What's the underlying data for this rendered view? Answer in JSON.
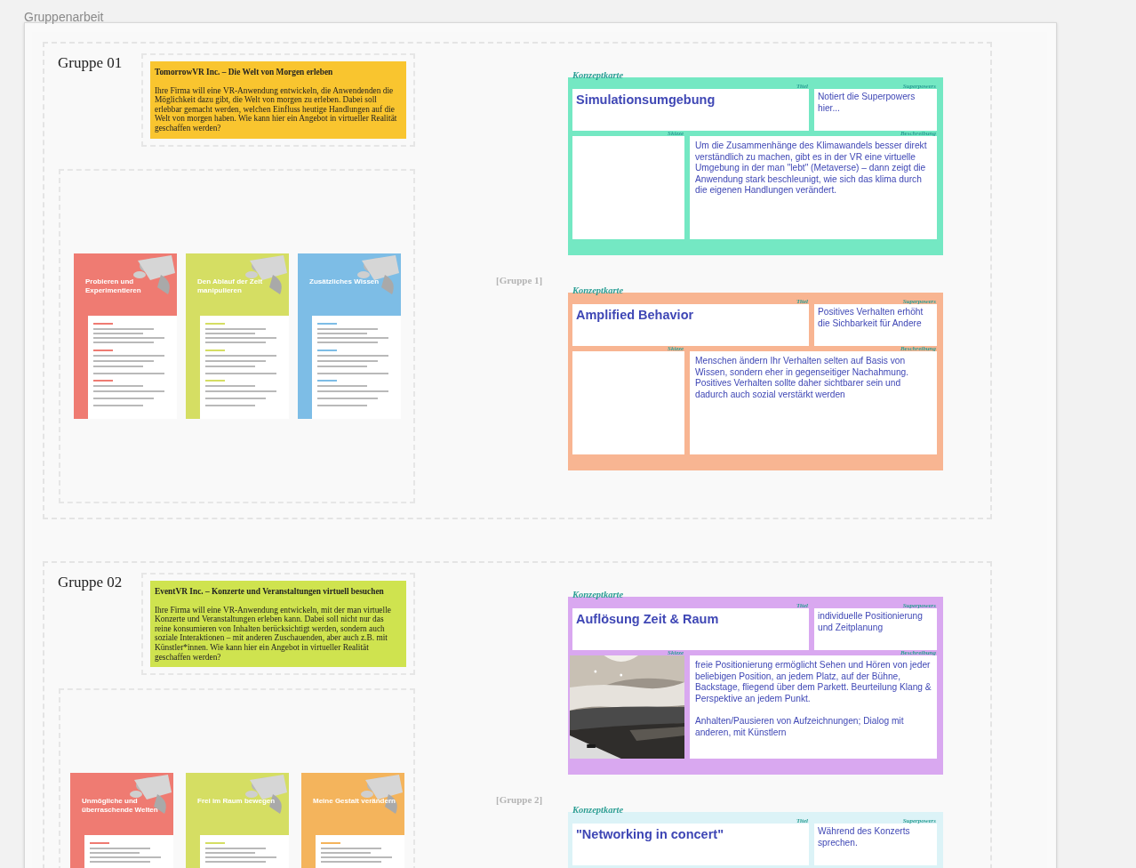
{
  "board": {
    "title": "Gruppenarbeit"
  },
  "groups": [
    {
      "label": "Gruppe 01",
      "tag": "[Gruppe 1]",
      "task": {
        "title": "TomorrowVR Inc. – Die Welt von Morgen erleben",
        "text": "Ihre Firma will eine VR-Anwendung entwickeln, die Anwendenden die Möglichkeit dazu gibt, die Welt von morgen zu erleben. Dabei soll erlebbar gemacht werden, welchen Einfluss heutige Handlungen auf die Welt von morgen haben. Wie kann hier ein Angebot in virtueller Realität geschaffen werden?",
        "color": "#f9c52f"
      },
      "method_cards": [
        {
          "title": "Probieren und Experimentieren",
          "color": "#ef7b72"
        },
        {
          "title": "Den Ablauf der Zeit manipulieren",
          "color": "#d5de63"
        },
        {
          "title": "Zusätzliches Wissen",
          "color": "#7dbde6"
        }
      ],
      "concept_cards": [
        {
          "heading": "Konzeptkarte",
          "color": "#74e8c3",
          "title_label": "Titel",
          "title": "Simulationsumgebung",
          "superpowers_label": "Superpowers",
          "superpowers": "Notiert die Superpowers hier...",
          "sketch_label": "Skizze",
          "sketch": {
            "kind": "empty"
          },
          "description_label": "Beschreibung",
          "description": "Um die Zusammenhänge des Klimawandels besser direkt verständlich zu machen, gibt es in der VR eine virtuelle Umgebung in der man \"lebt\" (Metaverse) – dann zeigt die Anwendung stark beschleunigt, wie sich das klima durch die eigenen Handlungen verändert."
        },
        {
          "heading": "Konzeptkarte",
          "color": "#f8b592",
          "title_label": "Titel",
          "title": "Amplified Behavior",
          "superpowers_label": "Superpowers",
          "superpowers": "Positives Verhalten erhöht die Sichbarkeit für Andere",
          "sketch_label": "Skizze",
          "sketch": {
            "kind": "empty"
          },
          "description_label": "Beschreibung",
          "description": "Menschen ändern Ihr Verhalten selten auf Basis von Wissen, sondern eher in gegenseitiger Nachahmung. Positives Verhalten sollte daher sichtbarer sein und dadurch auch sozial verstärkt werden"
        }
      ]
    },
    {
      "label": "Gruppe 02",
      "tag": "[Gruppe 2]",
      "task": {
        "title": "EventVR Inc. – Konzerte und Veranstaltungen virtuell besuchen",
        "text": "Ihre Firma will eine VR-Anwendung entwickeln, mit der man virtuelle Konzerte und Veranstaltungen erleben kann. Dabei soll nicht nur das reine konsumieren von Inhalten berücksichtigt werden, sondern auch soziale Interaktionen – mit anderen Zuschauenden, aber auch z.B. mit Künstler*innen. Wie kann hier ein Angebot in virtueller Realität geschaffen werden?",
        "color": "#cfe34f"
      },
      "method_cards": [
        {
          "title": "Unmögliche und überraschende Welten",
          "color": "#ef7b72"
        },
        {
          "title": "Frei im Raum bewegen",
          "color": "#d5de63"
        },
        {
          "title": "Meine Gestalt verändern",
          "color": "#f4b45c"
        }
      ],
      "concept_cards": [
        {
          "heading": "Konzeptkarte",
          "color": "#d9a8f0",
          "title_label": "Titel",
          "title": "Auflösung Zeit & Raum",
          "superpowers_label": "Superpowers",
          "superpowers": "individuelle Positionierung und Zeitplanung",
          "sketch_label": "Skizze",
          "description_label": "Beschreibung",
          "description": "freie Positionierung ermöglicht Sehen und Hören von jeder beliebigen Position, an jedem Platz, auf der Bühne, Backstage, fliegend über dem Parkett. Beurteilung Klang & Perspektive an jedem Punkt.\n\nAnhalten/Pausieren von Aufzeichnungen; Dialog mit anderen, mit Künstlern"
        },
        {
          "heading": "Konzeptkarte",
          "color": "#dcf3f7",
          "title_label": "Titel",
          "title": "\"Networking in concert\"",
          "superpowers_label": "Superpowers",
          "superpowers": "Während des Konzerts sprechen."
        }
      ]
    }
  ]
}
